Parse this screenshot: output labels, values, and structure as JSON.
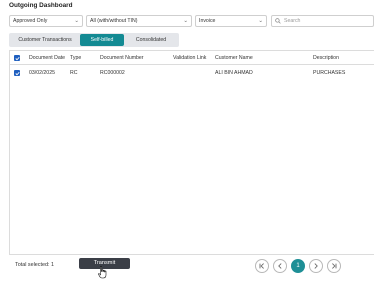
{
  "page": {
    "title": "Outgoing Dashboard"
  },
  "filters": {
    "status": {
      "value": "Approved Only"
    },
    "tin": {
      "value": "All (with/without TIN)"
    },
    "doc_type": {
      "value": "Invoice"
    },
    "search": {
      "placeholder": "Search"
    }
  },
  "tabs": [
    {
      "label": "Customer Transactions",
      "active": false
    },
    {
      "label": "Self-billed",
      "active": true
    },
    {
      "label": "Consolidated",
      "active": false
    }
  ],
  "table": {
    "headers": [
      "Document Date",
      "Type",
      "Document Number",
      "Validation Link",
      "Customer Name",
      "Description"
    ],
    "rows": [
      {
        "date": "03/02/2025",
        "type": "RC",
        "number": "RC000002",
        "link": "",
        "customer": "ALI BIN AHMAD",
        "description": "PURCHASES",
        "checked": true
      }
    ]
  },
  "footer": {
    "total_label": "Total selected:",
    "total_value": "1",
    "transmit_label": "Transmit"
  },
  "pagination": {
    "current_page": "1"
  },
  "colors": {
    "accent": "#138a93",
    "checkbox": "#1f5fbf",
    "button_dark": "#3b3f47"
  }
}
